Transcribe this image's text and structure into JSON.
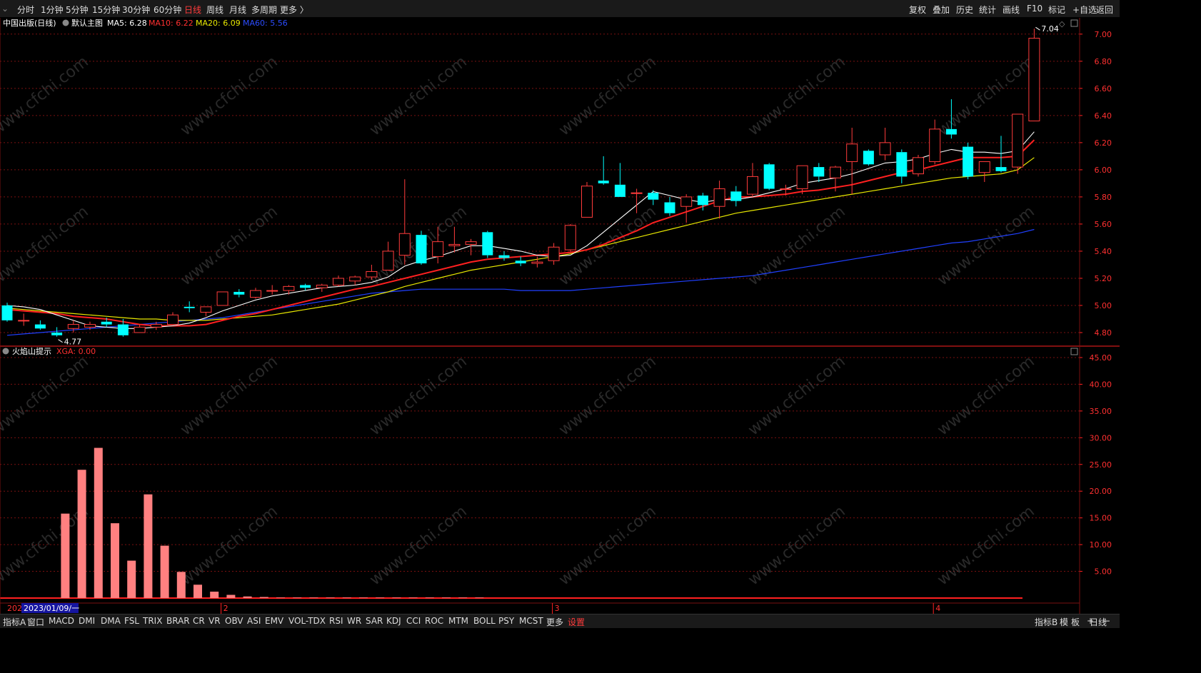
{
  "toolbar": {
    "periods": [
      "分时",
      "1分钟",
      "5分钟",
      "15分钟",
      "30分钟",
      "60分钟",
      "日线",
      "周线",
      "月线",
      "多周期",
      "更多 〉"
    ],
    "active_period": "日线",
    "right_buttons": [
      "复权",
      "叠加",
      "历史",
      "统计",
      "画线",
      "F10",
      "标记",
      "+自选",
      "返回"
    ]
  },
  "main_header": {
    "name": "中国出版(日线)",
    "template": "默认主图",
    "ma5": "MA5: 6.28",
    "ma10": "MA10: 6.22",
    "ma20": "MA20: 6.09",
    "ma60": "MA60: 5.56"
  },
  "sub_header": {
    "name": "火焰山提示",
    "value": "XGA: 0.00"
  },
  "watermark": "www.cfchi.com",
  "colors": {
    "up": "#ff3b3b",
    "down": "#00ffff",
    "ma5": "#ffffff",
    "ma10": "#ff2020",
    "ma20": "#e8e800",
    "ma60": "#2040ff",
    "xga_bar": "#ff8080",
    "grid": "#7a1010"
  },
  "date_axis": {
    "start_label": "202",
    "cursor_label": "2023/01/09/一",
    "month_labels": [
      {
        "label": "2",
        "index": 13
      },
      {
        "label": "3",
        "index": 33
      },
      {
        "label": "4",
        "index": 56
      }
    ]
  },
  "chart_data": [
    {
      "type": "candlestick",
      "ylim": [
        4.7,
        7.12
      ],
      "yticks": [
        4.8,
        5.0,
        5.2,
        5.4,
        5.6,
        5.8,
        6.0,
        6.2,
        6.4,
        6.6,
        6.8,
        7.0
      ],
      "annotations": [
        {
          "label": "7.04",
          "index": 62,
          "value": 7.04
        },
        {
          "label": "4.77",
          "index": 3,
          "value": 4.77
        }
      ],
      "candles": [
        {
          "o": 5.0,
          "h": 5.02,
          "l": 4.88,
          "c": 4.89
        },
        {
          "o": 4.89,
          "h": 4.94,
          "l": 4.85,
          "c": 4.89
        },
        {
          "o": 4.86,
          "h": 4.89,
          "l": 4.82,
          "c": 4.83
        },
        {
          "o": 4.8,
          "h": 4.84,
          "l": 4.77,
          "c": 4.78
        },
        {
          "o": 4.83,
          "h": 4.89,
          "l": 4.8,
          "c": 4.86
        },
        {
          "o": 4.84,
          "h": 4.88,
          "l": 4.82,
          "c": 4.86
        },
        {
          "o": 4.88,
          "h": 4.91,
          "l": 4.84,
          "c": 4.86
        },
        {
          "o": 4.86,
          "h": 4.9,
          "l": 4.77,
          "c": 4.78
        },
        {
          "o": 4.8,
          "h": 4.86,
          "l": 4.8,
          "c": 4.84
        },
        {
          "o": 4.84,
          "h": 4.88,
          "l": 4.82,
          "c": 4.86
        },
        {
          "o": 4.86,
          "h": 4.95,
          "l": 4.86,
          "c": 4.93
        },
        {
          "o": 4.99,
          "h": 5.03,
          "l": 4.95,
          "c": 4.98
        },
        {
          "o": 4.95,
          "h": 4.99,
          "l": 4.92,
          "c": 4.99
        },
        {
          "o": 5.0,
          "h": 5.1,
          "l": 5.0,
          "c": 5.1
        },
        {
          "o": 5.1,
          "h": 5.12,
          "l": 5.06,
          "c": 5.08
        },
        {
          "o": 5.06,
          "h": 5.13,
          "l": 5.05,
          "c": 5.11
        },
        {
          "o": 5.11,
          "h": 5.15,
          "l": 5.08,
          "c": 5.11
        },
        {
          "o": 5.11,
          "h": 5.15,
          "l": 5.08,
          "c": 5.14
        },
        {
          "o": 5.15,
          "h": 5.16,
          "l": 5.11,
          "c": 5.13
        },
        {
          "o": 5.13,
          "h": 5.16,
          "l": 5.1,
          "c": 5.15
        },
        {
          "o": 5.15,
          "h": 5.22,
          "l": 5.14,
          "c": 5.2
        },
        {
          "o": 5.18,
          "h": 5.22,
          "l": 5.15,
          "c": 5.21
        },
        {
          "o": 5.21,
          "h": 5.3,
          "l": 5.19,
          "c": 5.25
        },
        {
          "o": 5.26,
          "h": 5.47,
          "l": 5.26,
          "c": 5.4
        },
        {
          "o": 5.37,
          "h": 5.93,
          "l": 5.3,
          "c": 5.53
        },
        {
          "o": 5.52,
          "h": 5.55,
          "l": 5.3,
          "c": 5.31
        },
        {
          "o": 5.36,
          "h": 5.58,
          "l": 5.31,
          "c": 5.47
        },
        {
          "o": 5.44,
          "h": 5.58,
          "l": 5.39,
          "c": 5.45
        },
        {
          "o": 5.45,
          "h": 5.49,
          "l": 5.37,
          "c": 5.47
        },
        {
          "o": 5.54,
          "h": 5.55,
          "l": 5.35,
          "c": 5.37
        },
        {
          "o": 5.37,
          "h": 5.4,
          "l": 5.33,
          "c": 5.35
        },
        {
          "o": 5.33,
          "h": 5.36,
          "l": 5.29,
          "c": 5.31
        },
        {
          "o": 5.31,
          "h": 5.36,
          "l": 5.28,
          "c": 5.32
        },
        {
          "o": 5.33,
          "h": 5.46,
          "l": 5.3,
          "c": 5.43
        },
        {
          "o": 5.41,
          "h": 5.6,
          "l": 5.39,
          "c": 5.59
        },
        {
          "o": 5.65,
          "h": 5.91,
          "l": 5.65,
          "c": 5.88
        },
        {
          "o": 5.92,
          "h": 6.1,
          "l": 5.89,
          "c": 5.9
        },
        {
          "o": 5.89,
          "h": 6.05,
          "l": 5.8,
          "c": 5.8
        },
        {
          "o": 5.83,
          "h": 5.86,
          "l": 5.68,
          "c": 5.83
        },
        {
          "o": 5.83,
          "h": 5.85,
          "l": 5.74,
          "c": 5.78
        },
        {
          "o": 5.76,
          "h": 5.8,
          "l": 5.66,
          "c": 5.68
        },
        {
          "o": 5.73,
          "h": 5.82,
          "l": 5.61,
          "c": 5.8
        },
        {
          "o": 5.81,
          "h": 5.83,
          "l": 5.7,
          "c": 5.74
        },
        {
          "o": 5.73,
          "h": 5.92,
          "l": 5.64,
          "c": 5.86
        },
        {
          "o": 5.84,
          "h": 5.88,
          "l": 5.73,
          "c": 5.77
        },
        {
          "o": 5.82,
          "h": 6.05,
          "l": 5.8,
          "c": 5.95
        },
        {
          "o": 6.04,
          "h": 6.05,
          "l": 5.85,
          "c": 5.86
        },
        {
          "o": 5.86,
          "h": 5.89,
          "l": 5.81,
          "c": 5.86
        },
        {
          "o": 5.86,
          "h": 6.03,
          "l": 5.82,
          "c": 6.03
        },
        {
          "o": 6.02,
          "h": 6.05,
          "l": 5.91,
          "c": 5.95
        },
        {
          "o": 5.94,
          "h": 6.03,
          "l": 5.84,
          "c": 6.02
        },
        {
          "o": 6.06,
          "h": 6.31,
          "l": 5.82,
          "c": 6.19
        },
        {
          "o": 6.14,
          "h": 6.15,
          "l": 6.03,
          "c": 6.04
        },
        {
          "o": 6.11,
          "h": 6.31,
          "l": 6.07,
          "c": 6.2
        },
        {
          "o": 6.13,
          "h": 6.15,
          "l": 5.9,
          "c": 5.95
        },
        {
          "o": 5.97,
          "h": 6.11,
          "l": 5.95,
          "c": 6.09
        },
        {
          "o": 6.06,
          "h": 6.37,
          "l": 6.04,
          "c": 6.3
        },
        {
          "o": 6.3,
          "h": 6.52,
          "l": 6.23,
          "c": 6.26
        },
        {
          "o": 6.17,
          "h": 6.2,
          "l": 5.93,
          "c": 5.95
        },
        {
          "o": 5.98,
          "h": 6.06,
          "l": 5.91,
          "c": 6.06
        },
        {
          "o": 6.02,
          "h": 6.25,
          "l": 5.98,
          "c": 5.99
        },
        {
          "o": 6.02,
          "h": 6.41,
          "l": 5.97,
          "c": 6.41
        },
        {
          "o": 6.36,
          "h": 7.04,
          "l": 6.36,
          "c": 6.97
        }
      ],
      "ma5": [
        5.0,
        4.99,
        4.97,
        4.93,
        4.89,
        4.85,
        4.84,
        4.83,
        4.83,
        4.84,
        4.85,
        4.87,
        4.91,
        4.96,
        5.0,
        5.04,
        5.07,
        5.09,
        5.11,
        5.13,
        5.14,
        5.15,
        5.17,
        5.21,
        5.29,
        5.33,
        5.36,
        5.4,
        5.44,
        5.44,
        5.42,
        5.4,
        5.37,
        5.36,
        5.37,
        5.44,
        5.54,
        5.64,
        5.74,
        5.84,
        5.81,
        5.78,
        5.76,
        5.78,
        5.78,
        5.8,
        5.83,
        5.86,
        5.9,
        5.92,
        5.94,
        5.97,
        6.01,
        6.05,
        6.06,
        6.08,
        6.12,
        6.15,
        6.13,
        6.13,
        6.12,
        6.14,
        6.28
      ],
      "ma10": [
        4.97,
        4.96,
        4.95,
        4.94,
        4.92,
        4.91,
        4.9,
        4.88,
        4.86,
        4.85,
        4.85,
        4.85,
        4.86,
        4.89,
        4.92,
        4.94,
        4.97,
        5.0,
        5.03,
        5.06,
        5.09,
        5.12,
        5.14,
        5.17,
        5.2,
        5.23,
        5.26,
        5.29,
        5.32,
        5.34,
        5.35,
        5.36,
        5.37,
        5.38,
        5.39,
        5.41,
        5.45,
        5.5,
        5.55,
        5.61,
        5.65,
        5.69,
        5.73,
        5.77,
        5.8,
        5.8,
        5.81,
        5.82,
        5.84,
        5.85,
        5.87,
        5.89,
        5.92,
        5.95,
        5.98,
        6.0,
        6.03,
        6.06,
        6.09,
        6.09,
        6.09,
        6.1,
        6.22
      ],
      "ma20": [
        4.98,
        4.97,
        4.96,
        4.95,
        4.94,
        4.93,
        4.92,
        4.91,
        4.9,
        4.9,
        4.89,
        4.89,
        4.89,
        4.9,
        4.91,
        4.92,
        4.93,
        4.95,
        4.97,
        4.99,
        5.01,
        5.04,
        5.07,
        5.1,
        5.14,
        5.17,
        5.2,
        5.23,
        5.26,
        5.28,
        5.3,
        5.32,
        5.34,
        5.36,
        5.38,
        5.41,
        5.44,
        5.47,
        5.5,
        5.53,
        5.56,
        5.59,
        5.62,
        5.65,
        5.68,
        5.7,
        5.72,
        5.74,
        5.76,
        5.78,
        5.8,
        5.82,
        5.84,
        5.86,
        5.88,
        5.9,
        5.92,
        5.94,
        5.95,
        5.96,
        5.97,
        6.0,
        6.09
      ],
      "ma60": [
        4.78,
        4.79,
        4.8,
        4.81,
        4.82,
        4.83,
        4.84,
        4.85,
        4.86,
        4.87,
        4.88,
        4.89,
        4.9,
        4.91,
        4.93,
        4.95,
        4.97,
        4.99,
        5.01,
        5.03,
        5.05,
        5.07,
        5.09,
        5.1,
        5.11,
        5.12,
        5.12,
        5.12,
        5.12,
        5.12,
        5.12,
        5.11,
        5.11,
        5.11,
        5.11,
        5.12,
        5.13,
        5.14,
        5.15,
        5.16,
        5.17,
        5.18,
        5.19,
        5.2,
        5.21,
        5.22,
        5.24,
        5.26,
        5.28,
        5.3,
        5.32,
        5.34,
        5.36,
        5.38,
        5.4,
        5.42,
        5.44,
        5.46,
        5.47,
        5.49,
        5.51,
        5.53,
        5.56
      ]
    },
    {
      "type": "bar",
      "series_name": "XGA",
      "ylim": [
        0,
        47
      ],
      "yticks": [
        5,
        10,
        15,
        20,
        25,
        30,
        35,
        40,
        45
      ],
      "values": [
        0,
        0,
        15.8,
        24.0,
        28.1,
        14.0,
        7.0,
        19.4,
        9.8,
        4.9,
        2.5,
        1.2,
        0.6,
        0.3,
        0.2,
        0.1,
        0.1,
        0.1,
        0.1,
        0.1,
        0.1,
        0.1,
        0.1,
        0.1,
        0.1,
        0.1,
        0.1,
        0.1
      ]
    }
  ],
  "bottom_bar": {
    "left_items": [
      "指标A",
      "窗口",
      "MACD",
      "DMI",
      "DMA",
      "FSL",
      "TRIX",
      "BRAR",
      "CR",
      "VR",
      "OBV",
      "ASI",
      "EMV",
      "VOL-TDX",
      "RSI",
      "WR",
      "SAR",
      "KDJ",
      "CCI",
      "ROC",
      "MTM",
      "BOLL",
      "PSY",
      "MCST",
      "更多",
      "设置"
    ],
    "right_items": [
      "指标B",
      "模",
      "板",
      "+",
      "−"
    ],
    "period_label": "日线"
  }
}
